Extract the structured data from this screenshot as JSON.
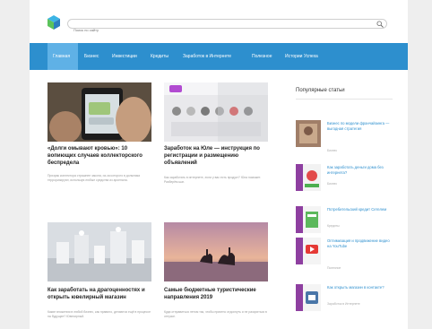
{
  "search": {
    "placeholder": "Поиск по сайту"
  },
  "nav": {
    "items": [
      {
        "label": "Главная"
      },
      {
        "label": "Бизнес"
      },
      {
        "label": "Инвестиции"
      },
      {
        "label": "Кредиты"
      },
      {
        "label": "Заработок в Интернете"
      },
      {
        "label": "Полезное"
      },
      {
        "label": "Истории Успеха"
      }
    ]
  },
  "articles": [
    {
      "title": "«Долги омывают кровью»: 10 вопиющих случаев коллекторского беспредела",
      "excerpt": "Призрак коллектора страшнее закона, из-за которого в должника терроризируют, используя любые средства из арсенала."
    },
    {
      "title": "Заработок на Юле — инструкция по регистрации и размещению объявлений",
      "excerpt": "Как заработать в интернете, если у вас есть продукт? Юла поможет. Разберём шаг."
    },
    {
      "title": "Как заработать на драгоценностях и открыть ювелирный магазин",
      "excerpt": "Какие вложения в любой бизнес, как правило, делаются ещё в процессе на будущее? Ювелирный."
    },
    {
      "title": "Самые бюджетные туристические направления 2019",
      "excerpt": "Куда отправиться летом так, чтобы приятно отдохнуть и не разориться в отпуске."
    }
  ],
  "sidebar": {
    "title": "Популярные статьи",
    "items": [
      {
        "title": "Бизнес по модели франчайзинга — выгодная стратегия",
        "category": "Бизнес"
      },
      {
        "title": "Как заработать деньги дома без интернета?",
        "category": "Бизнес"
      },
      {
        "title": "Потребительский кредит Сетелем",
        "category": "Кредиты"
      },
      {
        "title": "Оптимизация и продвижение видео на YouTube",
        "category": "Полезное"
      },
      {
        "title": "Как открыть магазин в контакте?",
        "category": "Заработок в Интернете"
      }
    ]
  },
  "colors": {
    "nav_bg": "#2d8fce",
    "nav_active": "#5fb1e6",
    "link": "#2d8fce"
  }
}
